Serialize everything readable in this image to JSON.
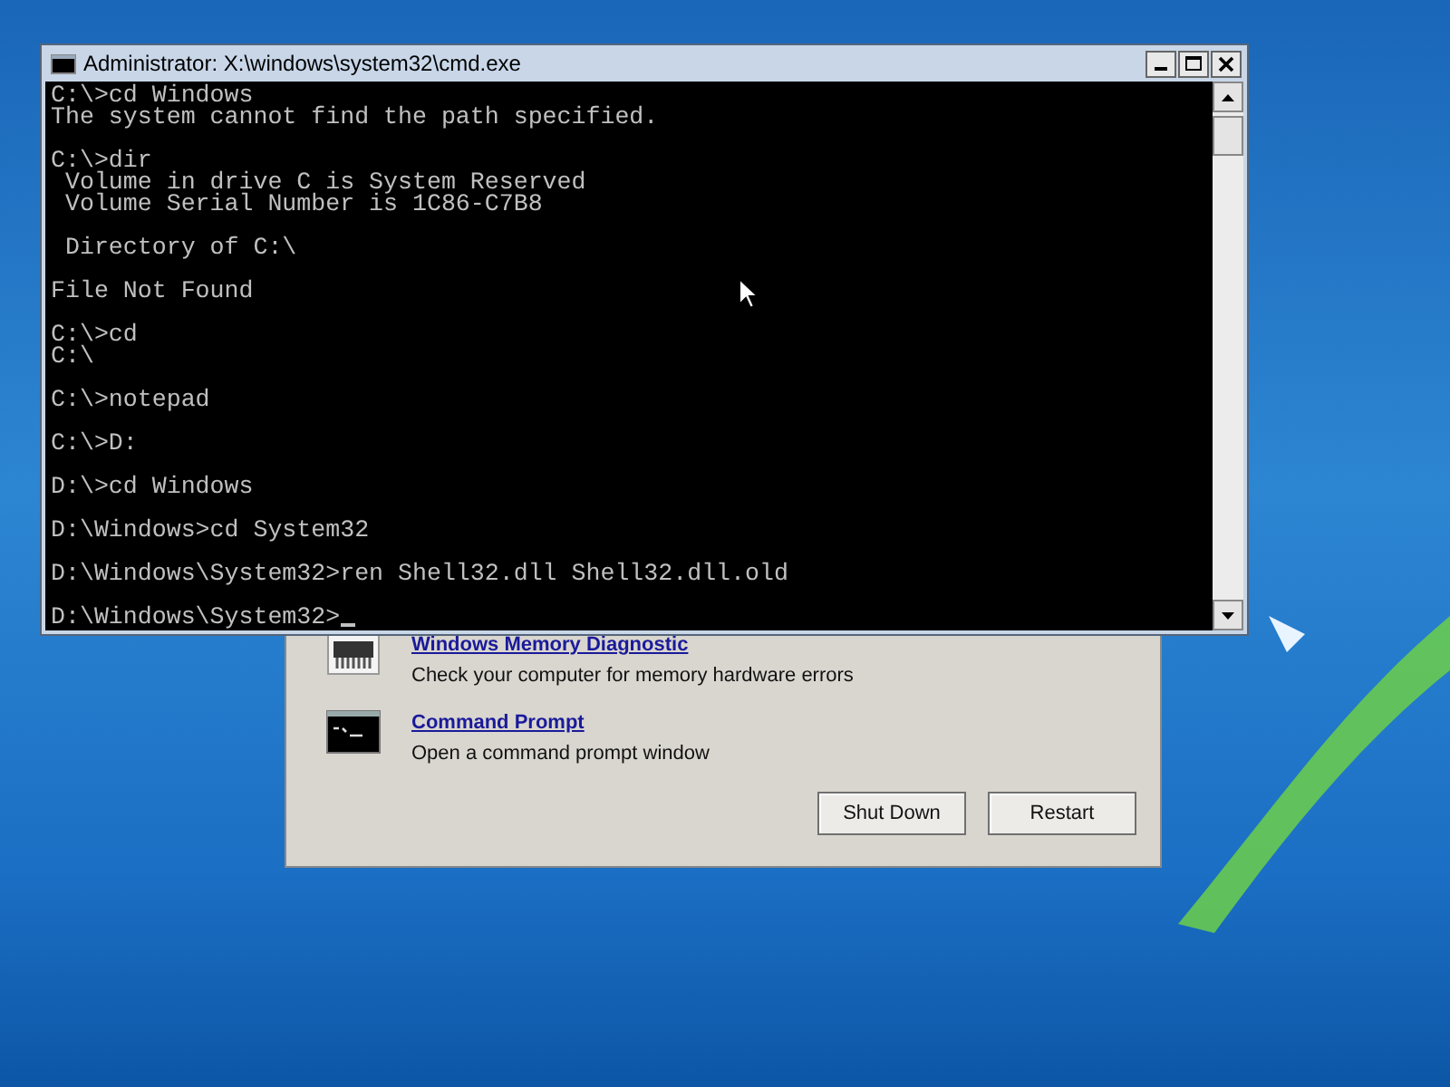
{
  "recovery_dialog": {
    "items": [
      {
        "kind": "memory",
        "link": "Windows Memory Diagnostic",
        "description": "Check your computer for memory hardware errors"
      },
      {
        "kind": "prompt",
        "link": "Command Prompt",
        "description": "Open a command prompt window"
      }
    ],
    "buttons": [
      "Shut Down",
      "Restart"
    ]
  },
  "console_window": {
    "title": "Administrator: X:\\windows\\system32\\cmd.exe",
    "blocks": [
      [
        "C:\\>cd Windows",
        "The system cannot find the path specified."
      ],
      [
        "C:\\>dir",
        " Volume in drive C is System Reserved",
        " Volume Serial Number is 1C86-C7B8"
      ],
      [
        " Directory of C:\\"
      ],
      [
        "File Not Found"
      ],
      [
        "C:\\>cd",
        "C:\\"
      ],
      [
        "C:\\>notepad"
      ],
      [
        "C:\\>D:"
      ],
      [
        "D:\\>cd Windows"
      ],
      [
        "D:\\Windows>cd System32"
      ],
      [
        "D:\\Windows\\System32>ren Shell32.dll Shell32.dll.old"
      ],
      [
        "D:\\Windows\\System32>"
      ]
    ]
  }
}
